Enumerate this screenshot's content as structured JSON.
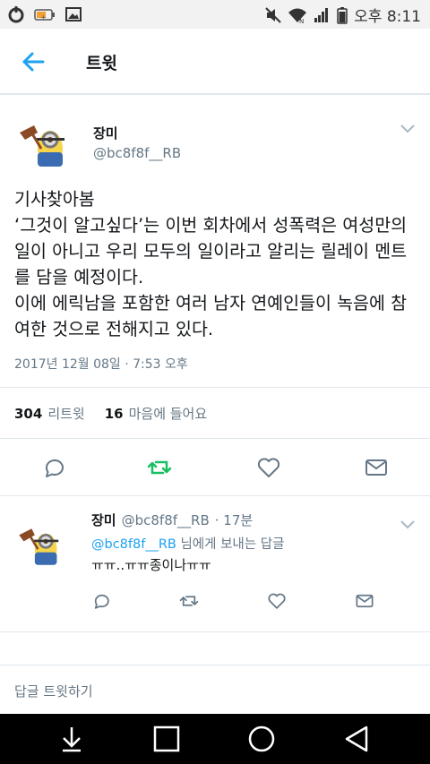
{
  "status_bar": {
    "time": "오후 8:11",
    "icons": [
      "carrier-icon",
      "battery-saver-icon",
      "gallery-icon",
      "mute-icon",
      "wifi-icon",
      "signal-icon",
      "battery-icon"
    ]
  },
  "header": {
    "title": "트윗",
    "back_icon": "arrow-left-icon"
  },
  "main_tweet": {
    "author_name": "장미",
    "author_handle": "@bc8f8f__RB",
    "text": "기사찾아봄\n‘그것이 알고싶다’는 이번 회차에서 성폭력은 여성만의 일이 아니고 우리 모두의 일이라고 알리는 릴레이 멘트를 담을 예정이다.\n이에 에릭남을 포함한 여러 남자 연예인들이 녹음에 참여한 것으로 전해지고 있다.",
    "timestamp": "2017년 12월 08일 · 7:53 오후",
    "retweet_count": "304",
    "retweet_label": "리트윗",
    "like_count": "16",
    "like_label": "마음에 들어요",
    "accent_color": "#1da1f2",
    "retweet_active_color": "#17bf63"
  },
  "reply_tweet": {
    "author_name": "장미",
    "author_handle": "@bc8f8f__RB",
    "time_ago": "· 17분",
    "reply_to_handle": "@bc8f8f__RB",
    "reply_to_suffix": " 님에게 보내는 답글",
    "text": "ㅠㅠ..ㅠㅠ종이나ㅠㅠ"
  },
  "compose": {
    "placeholder": "답글 트윗하기"
  }
}
